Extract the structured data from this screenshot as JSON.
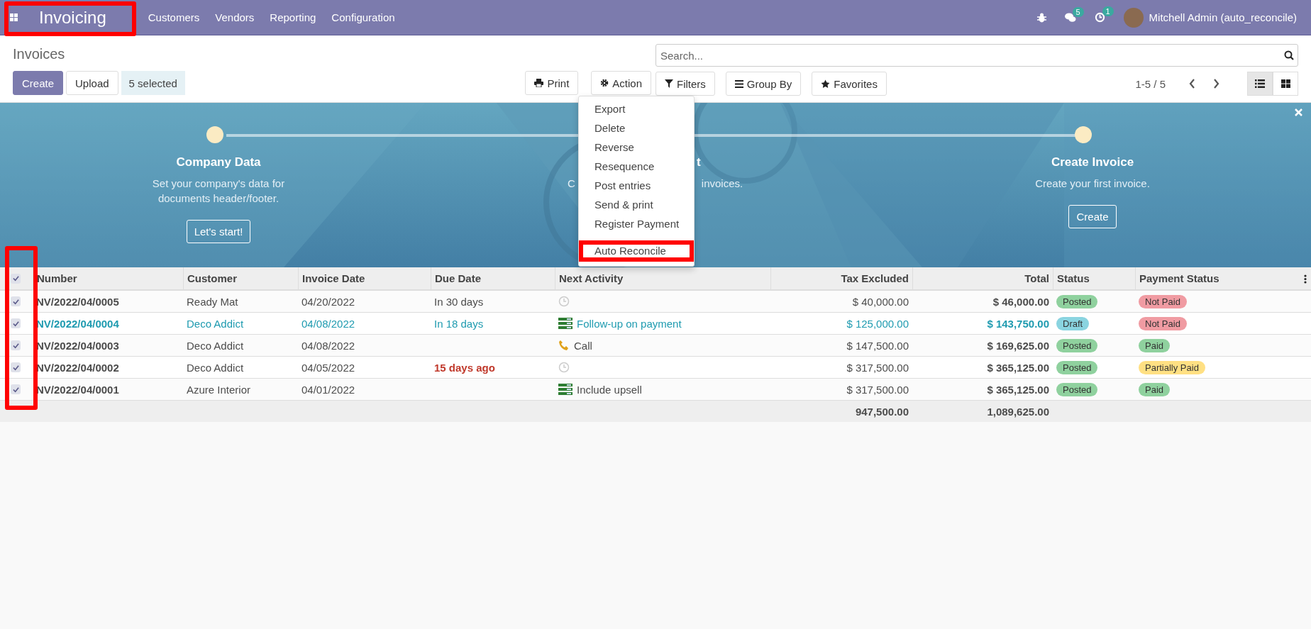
{
  "navbar": {
    "app": "Invoicing",
    "menus": [
      "Customers",
      "Vendors",
      "Reporting",
      "Configuration"
    ],
    "messages_badge": "5",
    "activities_badge": "1",
    "user": "Mitchell Admin (auto_reconcile)"
  },
  "control_panel": {
    "title": "Invoices",
    "buttons": [
      {
        "label": "Create",
        "kind": "primary"
      },
      {
        "label": "Upload",
        "kind": "secondary"
      }
    ],
    "selection": "5 selected",
    "print": "Print",
    "action": "Action",
    "search": {
      "placeholder": "Search..."
    },
    "filters": [
      {
        "label": "Filters",
        "kind": "filter"
      },
      {
        "label": "Group By",
        "kind": "group"
      },
      {
        "label": "Favorites",
        "kind": "star"
      }
    ],
    "pager": "1-5 / 5",
    "views": [
      {
        "kind": "list",
        "selected": true
      },
      {
        "kind": "kanban",
        "selected": false
      }
    ]
  },
  "action_menu": {
    "items": [
      {
        "label": "Export",
        "highlighted": false
      },
      {
        "label": "Delete",
        "highlighted": false
      },
      {
        "label": "Reverse",
        "highlighted": false
      },
      {
        "label": "Resequence",
        "highlighted": false
      },
      {
        "label": "Post entries",
        "highlighted": false
      },
      {
        "label": "Send & print",
        "highlighted": false
      },
      {
        "label": "Register Payment",
        "highlighted": false
      },
      {
        "label": "Auto Reconcile",
        "highlighted": true
      }
    ]
  },
  "onboarding": {
    "steps": [
      {
        "kind": "full",
        "title": "Company Data",
        "description": "Set your company's data for documents header/footer.",
        "button": "Let's start!"
      },
      {
        "kind": "covered",
        "title": "t",
        "description_parts": [
          "C",
          "invoices."
        ]
      },
      {
        "kind": "full",
        "title": "Create Invoice",
        "description": "Create your first invoice.",
        "button": "Create"
      }
    ]
  },
  "table": {
    "all_selected": true,
    "columns": [
      "Number",
      "Customer",
      "Invoice Date",
      "Due Date",
      "Next Activity",
      "Tax Excluded",
      "Total",
      "Status",
      "Payment Status"
    ],
    "rows": [
      {
        "selected": true,
        "draft": false,
        "number": "NV/2022/04/0005",
        "customer": "Ready Mat",
        "invoice_date": "04/20/2022",
        "due_date": "In 30 days",
        "overdue": false,
        "activity": {
          "kind": "clock"
        },
        "tax_excluded": "$ 40,000.00",
        "total": "$ 46,000.00",
        "status": {
          "label": "Posted",
          "color": "#8fd19e"
        },
        "payment_status": {
          "label": "Not Paid",
          "color": "#f09ba2"
        }
      },
      {
        "selected": true,
        "draft": true,
        "number": "NV/2022/04/0004",
        "customer": "Deco Addict",
        "invoice_date": "04/08/2022",
        "due_date": "In 18 days",
        "overdue": false,
        "activity": {
          "kind": "todo",
          "label": "Follow-up on payment"
        },
        "tax_excluded": "$ 125,000.00",
        "total": "$ 143,750.00",
        "status": {
          "label": "Draft",
          "color": "#8ad4e0"
        },
        "payment_status": {
          "label": "Not Paid",
          "color": "#f09ba2"
        }
      },
      {
        "selected": true,
        "draft": false,
        "number": "NV/2022/04/0003",
        "customer": "Deco Addict",
        "invoice_date": "04/08/2022",
        "activity": {
          "kind": "phone",
          "label": "Call"
        },
        "tax_excluded": "$ 147,500.00",
        "total": "$ 169,625.00",
        "status": {
          "label": "Posted",
          "color": "#8fd19e"
        },
        "payment_status": {
          "label": "Paid",
          "color": "#8fd19e"
        }
      },
      {
        "selected": true,
        "draft": false,
        "number": "NV/2022/04/0002",
        "customer": "Deco Addict",
        "invoice_date": "04/05/2022",
        "due_date": "15 days ago",
        "overdue": true,
        "activity": {
          "kind": "clock"
        },
        "tax_excluded": "$ 317,500.00",
        "total": "$ 365,125.00",
        "status": {
          "label": "Posted",
          "color": "#8fd19e"
        },
        "payment_status": {
          "label": "Partially Paid",
          "color": "#ffe083"
        }
      },
      {
        "selected": true,
        "draft": false,
        "number": "NV/2022/04/0001",
        "customer": "Azure Interior",
        "invoice_date": "04/01/2022",
        "activity": {
          "kind": "todo",
          "label": "Include upsell"
        },
        "tax_excluded": "$ 317,500.00",
        "total": "$ 365,125.00",
        "status": {
          "label": "Posted",
          "color": "#8fd19e"
        },
        "payment_status": {
          "label": "Paid",
          "color": "#8fd19e"
        }
      }
    ],
    "totals": {
      "tax_excluded": "947,500.00",
      "total": "1,089,625.00"
    }
  }
}
